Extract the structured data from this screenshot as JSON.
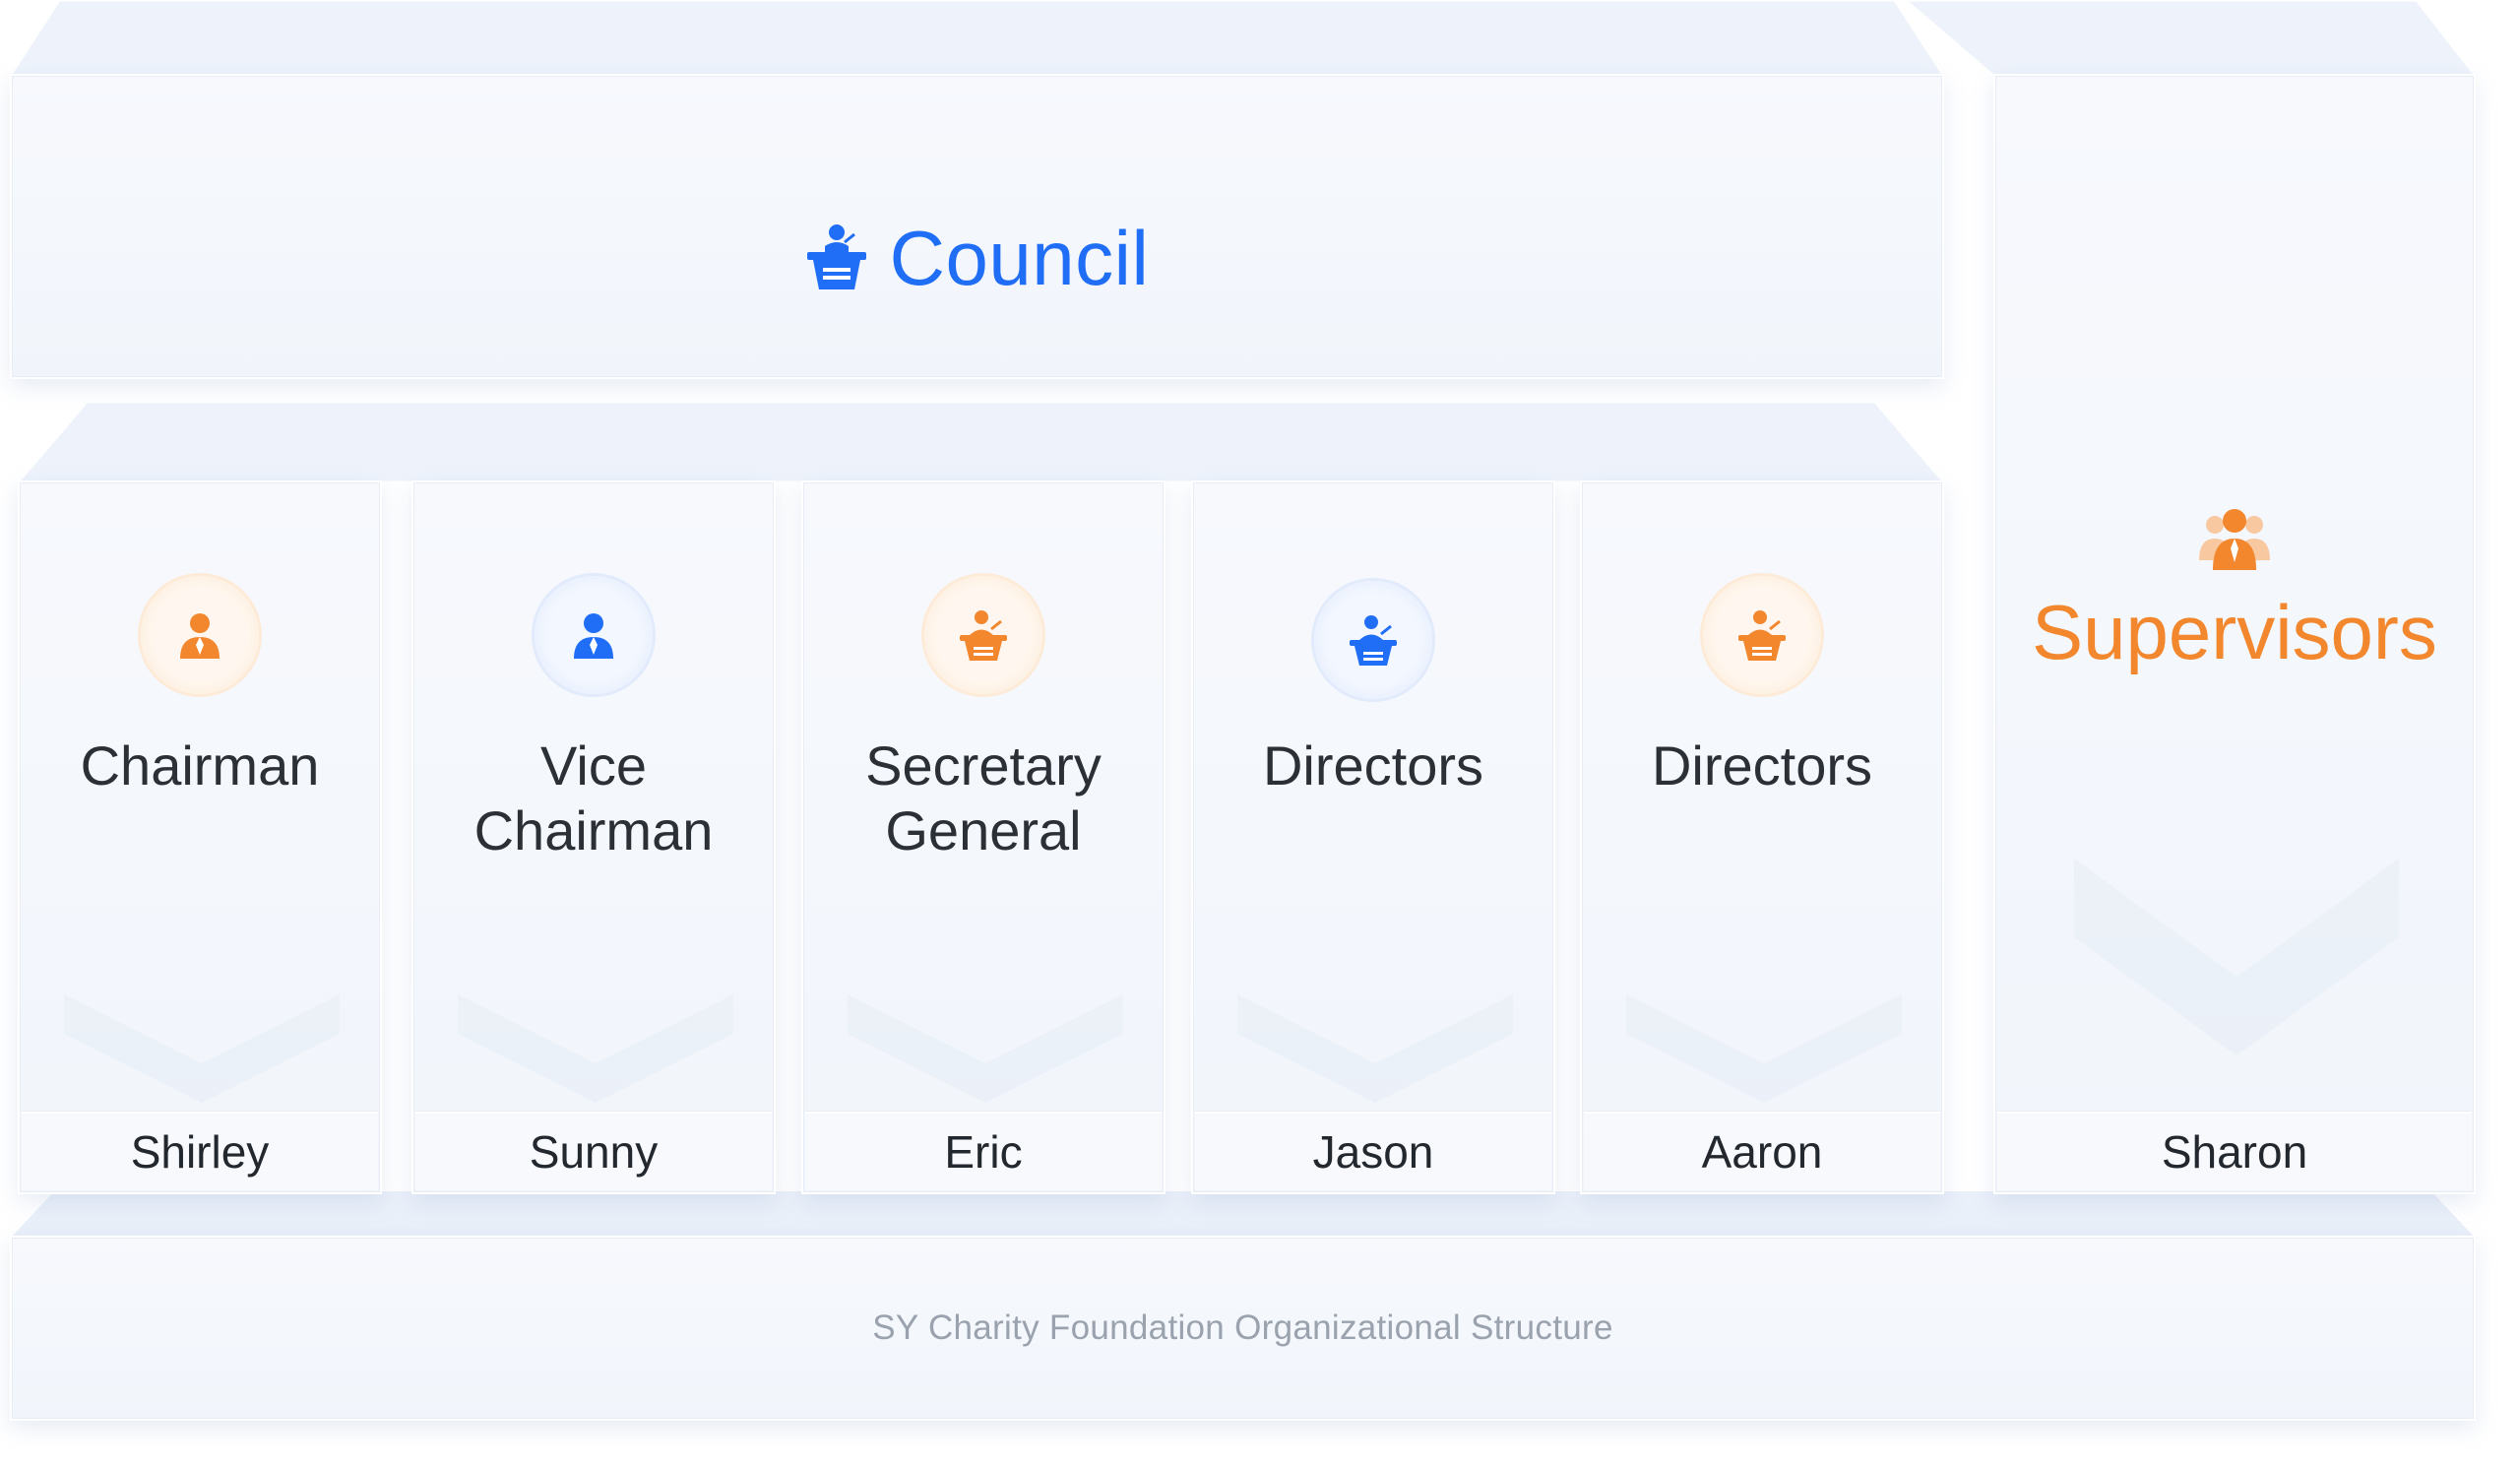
{
  "council": {
    "title": "Council",
    "icon": "podium-icon",
    "color": "#1f6ef5"
  },
  "columns": [
    {
      "title": "Chairman",
      "name": "Shirley",
      "icon": "person-icon",
      "theme": "orange"
    },
    {
      "title": "Vice Chairman",
      "name": "Sunny",
      "icon": "person-icon",
      "theme": "blue"
    },
    {
      "title": "Secretary General",
      "name": "Eric",
      "icon": "speaker-podium-icon",
      "theme": "orange"
    },
    {
      "title": "Directors",
      "name": "Jason",
      "icon": "speaker-podium-icon",
      "theme": "blue"
    },
    {
      "title": "Directors",
      "name": "Aaron",
      "icon": "speaker-podium-icon",
      "theme": "orange"
    }
  ],
  "supervisors": {
    "title": "Supervisors",
    "name": "Sharon",
    "icon": "group-icon",
    "color": "#f2872e"
  },
  "footer": {
    "caption": "SY Charity Foundation Organizational Structure"
  },
  "colors": {
    "orange": "#f2872e",
    "blue": "#1f6ef5",
    "text": "#2b2f36",
    "muted": "#9aa2ae"
  }
}
